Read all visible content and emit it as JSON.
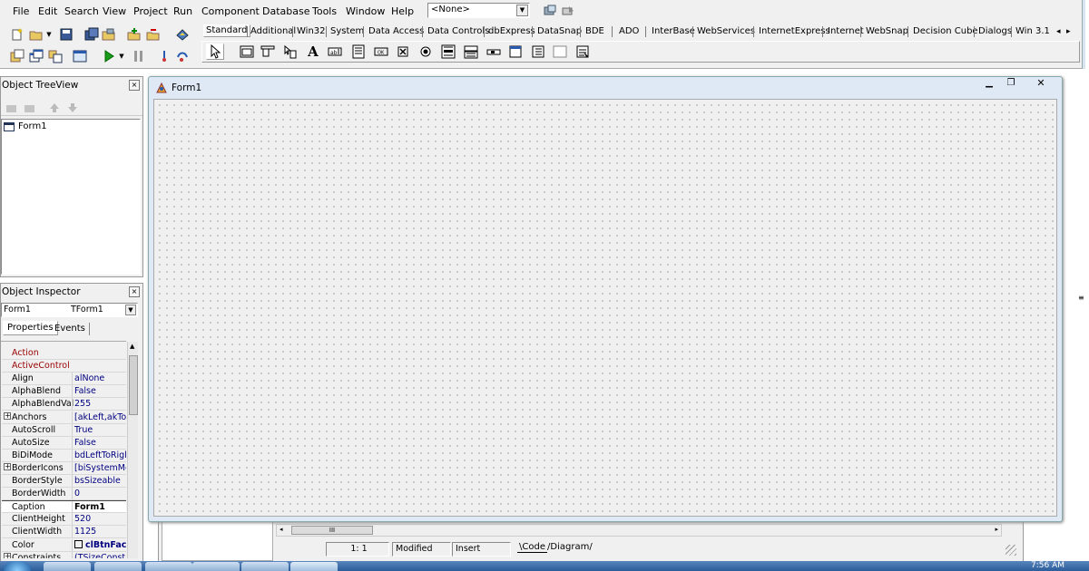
{
  "menu": [
    "File",
    "Edit",
    "Search",
    "View",
    "Project",
    "Run",
    "Component",
    "Database",
    "Tools",
    "Window",
    "Help"
  ],
  "combo_value": "<None>",
  "palette_tabs": [
    "Standard",
    "Additional",
    "Win32",
    "System",
    "Data Access",
    "Data Controls",
    "dbExpress",
    "DataSnap",
    "BDE",
    "ADO",
    "InterBase",
    "WebServices",
    "InternetExpress",
    "Internet",
    "WebSnap",
    "Decision Cube",
    "Dialogs",
    "Win 3.1"
  ],
  "tree_view": {
    "title": "Object TreeView",
    "item": "Form1"
  },
  "inspector": {
    "title": "Object Inspector",
    "object_name": "Form1",
    "object_type": "TForm1",
    "tabs": [
      "Properties",
      "Events"
    ],
    "rows": [
      {
        "name": "Action",
        "value": "",
        "red": true,
        "exp": false
      },
      {
        "name": "ActiveControl",
        "value": "",
        "red": true,
        "exp": false
      },
      {
        "name": "Align",
        "value": "alNone",
        "red": false,
        "exp": false
      },
      {
        "name": "AlphaBlend",
        "value": "False",
        "red": false,
        "exp": false
      },
      {
        "name": "AlphaBlendVal",
        "value": "255",
        "red": false,
        "exp": false
      },
      {
        "name": "Anchors",
        "value": "[akLeft,akTop",
        "red": false,
        "exp": true
      },
      {
        "name": "AutoScroll",
        "value": "True",
        "red": false,
        "exp": false
      },
      {
        "name": "AutoSize",
        "value": "False",
        "red": false,
        "exp": false
      },
      {
        "name": "BiDiMode",
        "value": "bdLeftToRigh",
        "red": false,
        "exp": false
      },
      {
        "name": "BorderIcons",
        "value": "[biSystemMen",
        "red": false,
        "exp": true
      },
      {
        "name": "BorderStyle",
        "value": "bsSizeable",
        "red": false,
        "exp": false
      },
      {
        "name": "BorderWidth",
        "value": "0",
        "red": false,
        "exp": false
      },
      {
        "name": "Caption",
        "value": "Form1",
        "red": false,
        "exp": false,
        "selected": true
      },
      {
        "name": "ClientHeight",
        "value": "520",
        "red": false,
        "exp": false
      },
      {
        "name": "ClientWidth",
        "value": "1125",
        "red": false,
        "exp": false
      },
      {
        "name": "Color",
        "value": "clBtnFac",
        "red": false,
        "exp": false,
        "swatch": true
      },
      {
        "name": "Constraints",
        "value": "(TSizeConstra",
        "red": false,
        "exp": true
      }
    ]
  },
  "form": {
    "title": "Form1"
  },
  "editor_status": {
    "position": "1:   1",
    "modified": "Modified",
    "mode": "Insert",
    "code_tab": "Code",
    "diagram_tab": "Diagram"
  },
  "scroll_grip": "III",
  "clock": "7:56 AM",
  "colors": {
    "accent": "#000080",
    "window": "#f0f0f0",
    "taskbar": "#2a5c9a"
  }
}
